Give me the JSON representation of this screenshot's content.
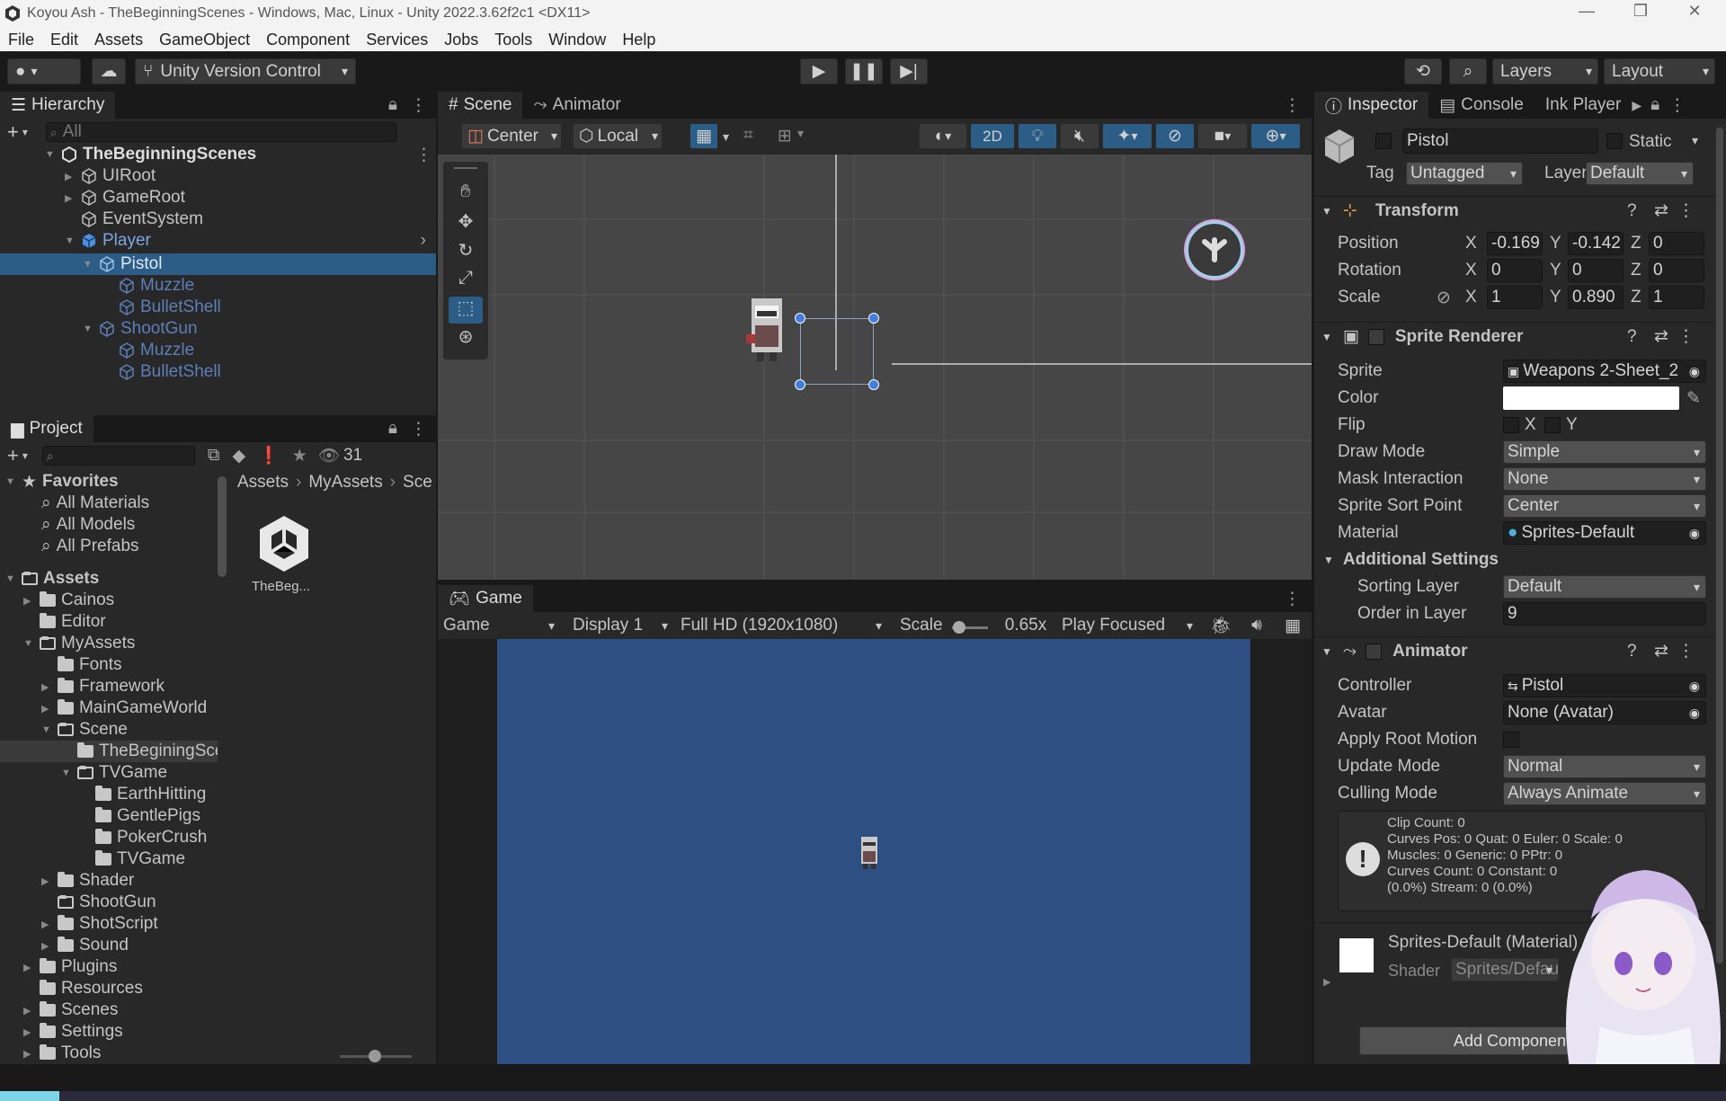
{
  "window": {
    "title": "Koyou Ash - TheBeginningScenes - Windows, Mac, Linux - Unity 2022.3.62f2c1 <DX11>"
  },
  "menu": [
    "File",
    "Edit",
    "Assets",
    "GameObject",
    "Component",
    "Services",
    "Jobs",
    "Tools",
    "Window",
    "Help"
  ],
  "toolbar": {
    "version_control": "Unity Version Control",
    "layers": "Layers",
    "layout": "Layout"
  },
  "hierarchy": {
    "tab": "Hierarchy",
    "search_placeholder": "All",
    "scene": "TheBeginningScenes",
    "items": [
      {
        "label": "UIRoot"
      },
      {
        "label": "GameRoot"
      },
      {
        "label": "EventSystem"
      },
      {
        "label": "Player"
      },
      {
        "label": "Pistol"
      },
      {
        "label": "Muzzle"
      },
      {
        "label": "BulletShell"
      },
      {
        "label": "ShootGun"
      },
      {
        "label": "Muzzle"
      },
      {
        "label": "BulletShell"
      }
    ]
  },
  "project": {
    "tab": "Project",
    "count": "31",
    "breadcrumb": [
      "Assets",
      "MyAssets",
      "Sce"
    ],
    "favorites_label": "Favorites",
    "favorites": [
      "All Materials",
      "All Models",
      "All Prefabs"
    ],
    "assets_label": "Assets",
    "tree": [
      "Cainos",
      "Editor",
      "MyAssets",
      "Fonts",
      "Framework",
      "MainGameWorld",
      "Scene",
      "TheBeginingSce",
      "TVGame",
      "EarthHitting",
      "GentlePigs",
      "PokerCrush",
      "TVGame",
      "Shader",
      "ShootGun",
      "ShotScript",
      "Sound",
      "Plugins",
      "Resources",
      "Scenes",
      "Settings",
      "Tools"
    ],
    "asset_item": "TheBeg..."
  },
  "scene_view": {
    "tabs": [
      "Scene",
      "Animator"
    ],
    "pivot": "Center",
    "space": "Local",
    "mode_2d": "2D"
  },
  "game_view": {
    "tab": "Game",
    "display_type": "Game",
    "display": "Display 1",
    "resolution": "Full HD (1920x1080)",
    "scale_label": "Scale",
    "scale_value": "0.65x",
    "play_mode": "Play Focused",
    "bg_color": "#2d4f82"
  },
  "inspector": {
    "tabs": [
      "Inspector",
      "Console",
      "Ink Player"
    ],
    "object_name": "Pistol",
    "static_label": "Static",
    "tag_label": "Tag",
    "tag": "Untagged",
    "layer_label": "Layer",
    "layer": "Default",
    "transform": {
      "title": "Transform",
      "labels": [
        "Position",
        "Rotation",
        "Scale"
      ],
      "position": {
        "x": "-0.169",
        "y": "-0.142",
        "z": "0"
      },
      "rotation": {
        "x": "0",
        "y": "0",
        "z": "0"
      },
      "scale": {
        "x": "1",
        "y": "0.890",
        "z": "1"
      }
    },
    "sprite_renderer": {
      "title": "Sprite Renderer",
      "labels": [
        "Sprite",
        "Color",
        "Flip",
        "Draw Mode",
        "Mask Interaction",
        "Sprite Sort Point",
        "Material"
      ],
      "sprite": "Weapons 2-Sheet_2",
      "flip_x": "X",
      "flip_y": "Y",
      "draw_mode": "Simple",
      "mask_interaction": "None",
      "sort_point": "Center",
      "material": "Sprites-Default",
      "additional": "Additional Settings",
      "sorting_layer_label": "Sorting Layer",
      "sorting_layer": "Default",
      "order_label": "Order in Layer",
      "order": "9"
    },
    "animator": {
      "title": "Animator",
      "labels": [
        "Controller",
        "Avatar",
        "Apply Root Motion",
        "Update Mode",
        "Culling Mode"
      ],
      "controller": "Pistol",
      "avatar": "None (Avatar)",
      "update_mode": "Normal",
      "culling_mode": "Always Animate",
      "info": [
        "Clip Count: 0",
        "Curves Pos: 0 Quat: 0 Euler: 0 Scale: 0",
        "Muscles: 0 Generic: 0 PPtr: 0",
        "Curves Count: 0 Constant: 0",
        "(0.0%) Stream: 0 (0.0%)"
      ]
    },
    "material": {
      "name": "Sprites-Default (Material)",
      "shader_label": "Shader",
      "shader": "Sprites/Default"
    },
    "add_component": "Add Component"
  },
  "colors": {
    "accent": "#2c5d87",
    "selection": "#2c5d87",
    "blue_icon": "#4a8fe0"
  }
}
